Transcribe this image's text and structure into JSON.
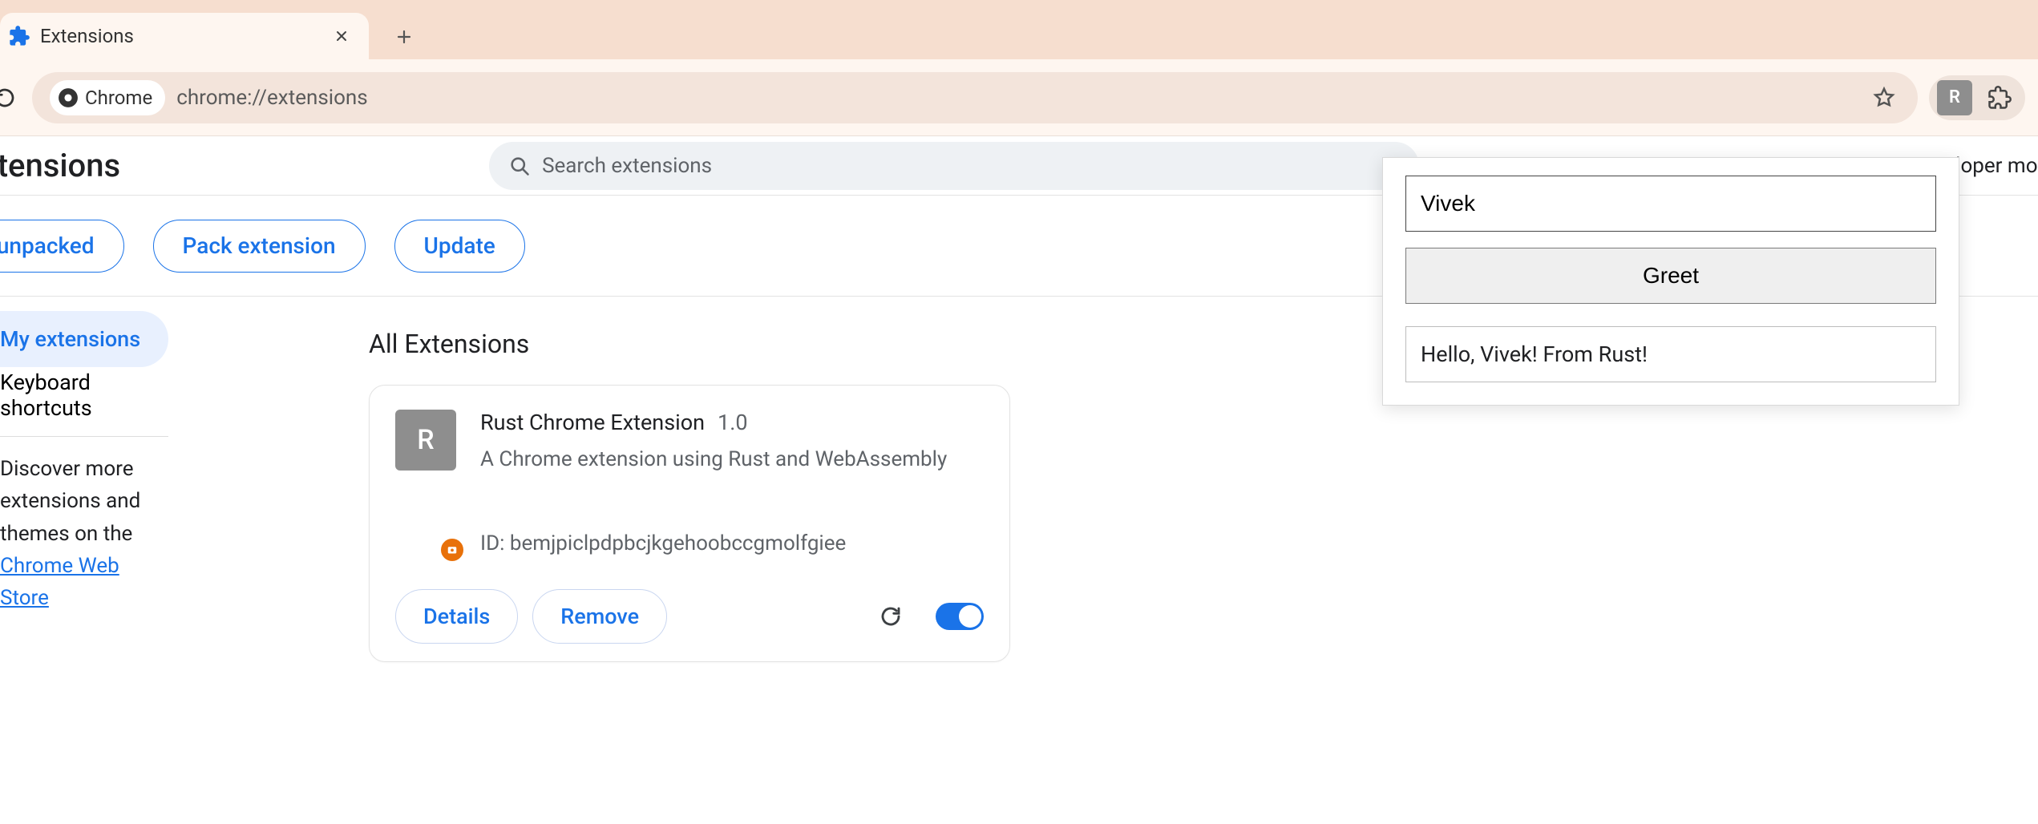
{
  "tab": {
    "title": "Extensions"
  },
  "addr": {
    "chip_label": "Chrome",
    "url": "chrome://extensions"
  },
  "profile_letter": "R",
  "page": {
    "title": "Extensions",
    "search_placeholder": "Search extensions",
    "dev_mode_label": "Developer mode"
  },
  "actions": {
    "load_unpacked": "Load unpacked",
    "pack": "Pack extension",
    "update": "Update"
  },
  "sidebar": {
    "my_extensions": "My extensions",
    "shortcuts": "Keyboard shortcuts",
    "note_pre": "Discover more extensions and themes on the ",
    "note_link": "Chrome Web Store"
  },
  "section": {
    "all": "All Extensions"
  },
  "ext": {
    "icon_letter": "R",
    "name": "Rust Chrome Extension",
    "version": "1.0",
    "desc": "A Chrome extension using Rust and WebAssembly",
    "id_label": "ID: bemjpiclpdpbcjkgehoobccgmolfgiee",
    "details": "Details",
    "remove": "Remove"
  },
  "popup": {
    "input_value": "Vivek",
    "button": "Greet",
    "output": "Hello, Vivek! From Rust!"
  }
}
